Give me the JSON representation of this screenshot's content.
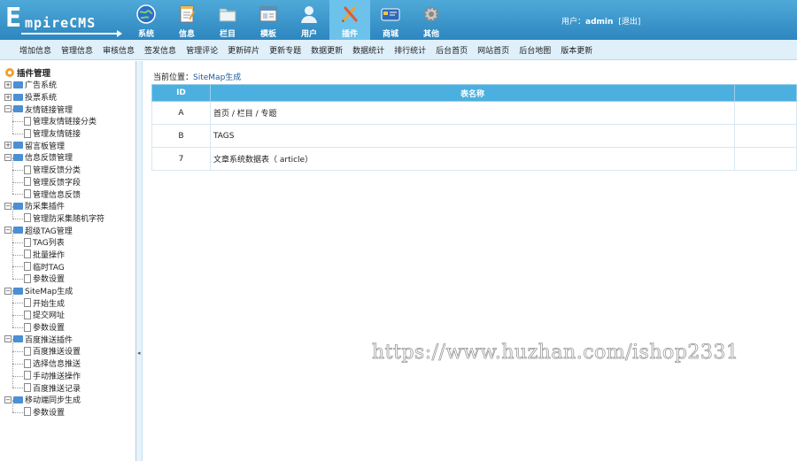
{
  "logo": {
    "first": "E",
    "rest": "mpireCMS"
  },
  "nav": [
    {
      "label": "系统",
      "icon": "globe-icon"
    },
    {
      "label": "信息",
      "icon": "notepad-icon"
    },
    {
      "label": "栏目",
      "icon": "folder-icon"
    },
    {
      "label": "模板",
      "icon": "window-icon"
    },
    {
      "label": "用户",
      "icon": "user-icon"
    },
    {
      "label": "插件",
      "icon": "tools-icon",
      "active": true
    },
    {
      "label": "商城",
      "icon": "card-icon"
    },
    {
      "label": "其他",
      "icon": "gear-icon"
    }
  ],
  "user": {
    "prefix": "用户：",
    "name": "admin",
    "logout": "[退出]"
  },
  "subnav": [
    "增加信息",
    "管理信息",
    "审核信息",
    "签发信息",
    "管理评论",
    "更新碎片",
    "更新专题",
    "数据更新",
    "数据统计",
    "排行统计",
    "后台首页",
    "网站首页",
    "后台地图",
    "版本更新"
  ],
  "sidebar": {
    "root": "插件管理",
    "nodes": [
      {
        "label": "广告系统",
        "expanded": false,
        "children": []
      },
      {
        "label": "投票系统",
        "expanded": false,
        "children": []
      },
      {
        "label": "友情链接管理",
        "expanded": true,
        "children": [
          "管理友情链接分类",
          "管理友情链接"
        ]
      },
      {
        "label": "留言板管理",
        "expanded": false,
        "children": []
      },
      {
        "label": "信息反馈管理",
        "expanded": true,
        "children": [
          "管理反馈分类",
          "管理反馈字段",
          "管理信息反馈"
        ]
      },
      {
        "label": "防采集插件",
        "expanded": true,
        "children": [
          "管理防采集随机字符"
        ]
      },
      {
        "label": "超级TAG管理",
        "expanded": true,
        "children": [
          "TAG列表",
          "批量操作",
          "临时TAG",
          "参数设置"
        ]
      },
      {
        "label": "SiteMap生成",
        "expanded": true,
        "children": [
          "开始生成",
          "提交网址",
          "参数设置"
        ]
      },
      {
        "label": "百度推送插件",
        "expanded": true,
        "children": [
          "百度推送设置",
          "选择信息推送",
          "手动推送操作",
          "百度推送记录"
        ]
      },
      {
        "label": "移动端同步生成",
        "expanded": true,
        "children": [
          "参数设置"
        ]
      }
    ]
  },
  "splitter_arrow": "◂",
  "breadcrumb": {
    "prefix": "当前位置：",
    "link": "SiteMap生成"
  },
  "table": {
    "headers": [
      "ID",
      "表名称",
      ""
    ],
    "rows": [
      {
        "id": "A",
        "name": "首页 / 栏目 / 专题"
      },
      {
        "id": "B",
        "name": "TAGS"
      },
      {
        "id": "7",
        "name": "文章系统数据表（ article）"
      }
    ]
  },
  "watermark": "https://www.huzhan.com/ishop2331",
  "colors": {
    "topbar": "#3a97cb",
    "active_tab": "#6cc2ea",
    "table_header": "#4bb0e0",
    "subbar": "#dff0fb"
  }
}
